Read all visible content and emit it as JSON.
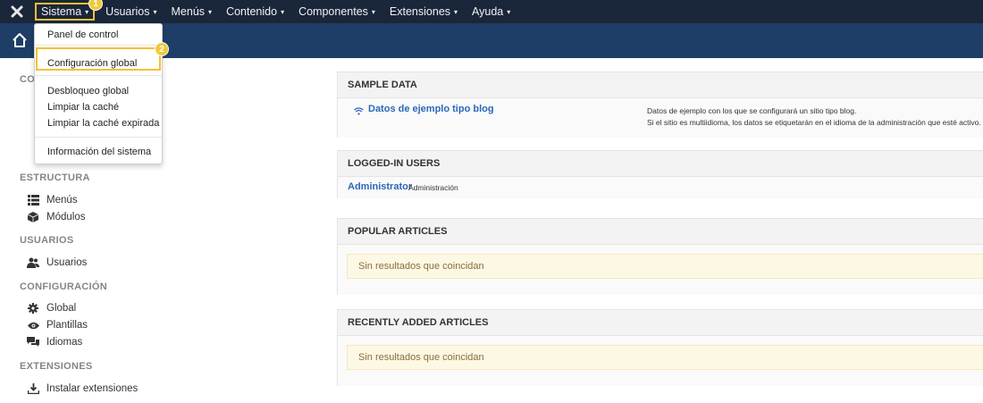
{
  "topnav": {
    "items": [
      {
        "label": "Sistema",
        "caret": "▾"
      },
      {
        "label": "Usuarios",
        "caret": "▾"
      },
      {
        "label": "Menús",
        "caret": "▾"
      },
      {
        "label": "Contenido",
        "caret": "▾"
      },
      {
        "label": "Componentes",
        "caret": "▾"
      },
      {
        "label": "Extensiones",
        "caret": "▾"
      },
      {
        "label": "Ayuda",
        "caret": "▾"
      }
    ],
    "badge1": "1"
  },
  "dropdown": {
    "items": [
      {
        "label": "Panel de control"
      },
      {
        "label": "Configuración global"
      },
      {
        "label": "Desbloqueo global"
      },
      {
        "label": "Limpiar la caché"
      },
      {
        "label": "Limpiar la caché expirada"
      },
      {
        "label": "Información del sistema"
      }
    ],
    "badge2": "2"
  },
  "sidebar": {
    "partial_head": "CO",
    "sections": [
      {
        "title": "ESTRUCTURA",
        "items": [
          {
            "label": "Menús",
            "icon": "list-icon"
          },
          {
            "label": "Módulos",
            "icon": "cube-icon"
          }
        ]
      },
      {
        "title": "USUARIOS",
        "items": [
          {
            "label": "Usuarios",
            "icon": "users-icon"
          }
        ]
      },
      {
        "title": "CONFIGURACIÓN",
        "items": [
          {
            "label": "Global",
            "icon": "gear-icon"
          },
          {
            "label": "Plantillas",
            "icon": "eye-icon"
          },
          {
            "label": "Idiomas",
            "icon": "comments-icon"
          }
        ]
      },
      {
        "title": "EXTENSIONES",
        "items": [
          {
            "label": "Instalar extensiones",
            "icon": "download-icon"
          }
        ]
      }
    ]
  },
  "cards": {
    "sample": {
      "title": "SAMPLE DATA",
      "link": "Datos de ejemplo tipo blog",
      "desc1": "Datos de ejemplo con los que se configurará un sitio tipo blog.",
      "desc2": "Si el sitio es multiidioma, los datos se etiquetarán en el idioma de la administración que esté activo."
    },
    "logged": {
      "title": "LOGGED-IN USERS",
      "user": "Administrator",
      "role": "Administración"
    },
    "popular": {
      "title": "POPULAR ARTICLES",
      "empty": "Sin resultados que coincidan"
    },
    "recent": {
      "title": "RECENTLY ADDED ARTICLES",
      "empty": "Sin resultados que coincidan"
    }
  },
  "colors": {
    "topbar": "#1a2639",
    "header": "#1f3e67",
    "highlight": "#f2c130",
    "link": "#2a69b8"
  }
}
